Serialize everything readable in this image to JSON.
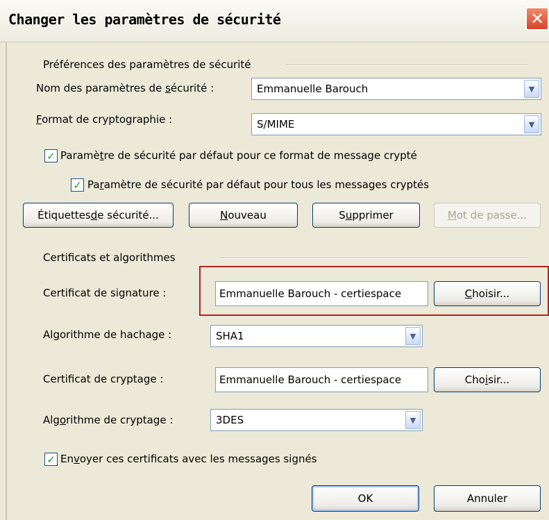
{
  "window": {
    "title": "Changer les paramètres de sécurité",
    "close_glyph": "✕"
  },
  "prefs": {
    "group_label": "Préférences des paramètres de sécurité",
    "name_label_pre": "Nom des paramètres de ",
    "name_label_u": "s",
    "name_label_post": "écurité :",
    "name_value": "Emmanuelle Barouch",
    "format_label_u": "F",
    "format_label_post": "ormat de cryptographie :",
    "format_value": "S/MIME",
    "check1_pre": "Paramè",
    "check1_u": "t",
    "check1_post": "re de sécurité par défaut pour ce format de message crypté",
    "check2_pre": "Pa",
    "check2_u": "r",
    "check2_post": "amètre de sécurité par défaut pour tous les messages cryptés"
  },
  "buttons": {
    "labels_pre": "Étiquettes ",
    "labels_u": "d",
    "labels_post": "e sécurité...",
    "new_u": "N",
    "new_post": "ouveau",
    "delete_pre": "S",
    "delete_u": "u",
    "delete_post": "pprimer",
    "password_u": "M",
    "password_post": "ot de passe...",
    "ok": "OK",
    "cancel": "Annuler"
  },
  "certs": {
    "group_label": "Certificats et algorithmes",
    "sign_label": "Certificat de signature :",
    "sign_value": "Emmanuelle Barouch - certiespace",
    "choose1_u": "C",
    "choose1_post": "hoisir...",
    "hash_label_pre": "Al",
    "hash_label_u": "g",
    "hash_label_post": "orithme de hachage :",
    "hash_value": "SHA1",
    "crypt_label": "Certificat de cryptage :",
    "crypt_value": "Emmanuelle Barouch - certiespace",
    "choose2_pre": "Cho",
    "choose2_u": "i",
    "choose2_post": "sir...",
    "calg_label_pre": "Alg",
    "calg_label_u": "o",
    "calg_label_post": "rithme de cryptage :",
    "calg_value": "3DES",
    "send_pre": "En",
    "send_u": "v",
    "send_post": "oyer ces certificats avec les messages signés"
  },
  "glyphs": {
    "check": "✓",
    "chevron": "▼"
  },
  "colors": {
    "highlight": "#b52121",
    "checkmark": "#21a121"
  }
}
